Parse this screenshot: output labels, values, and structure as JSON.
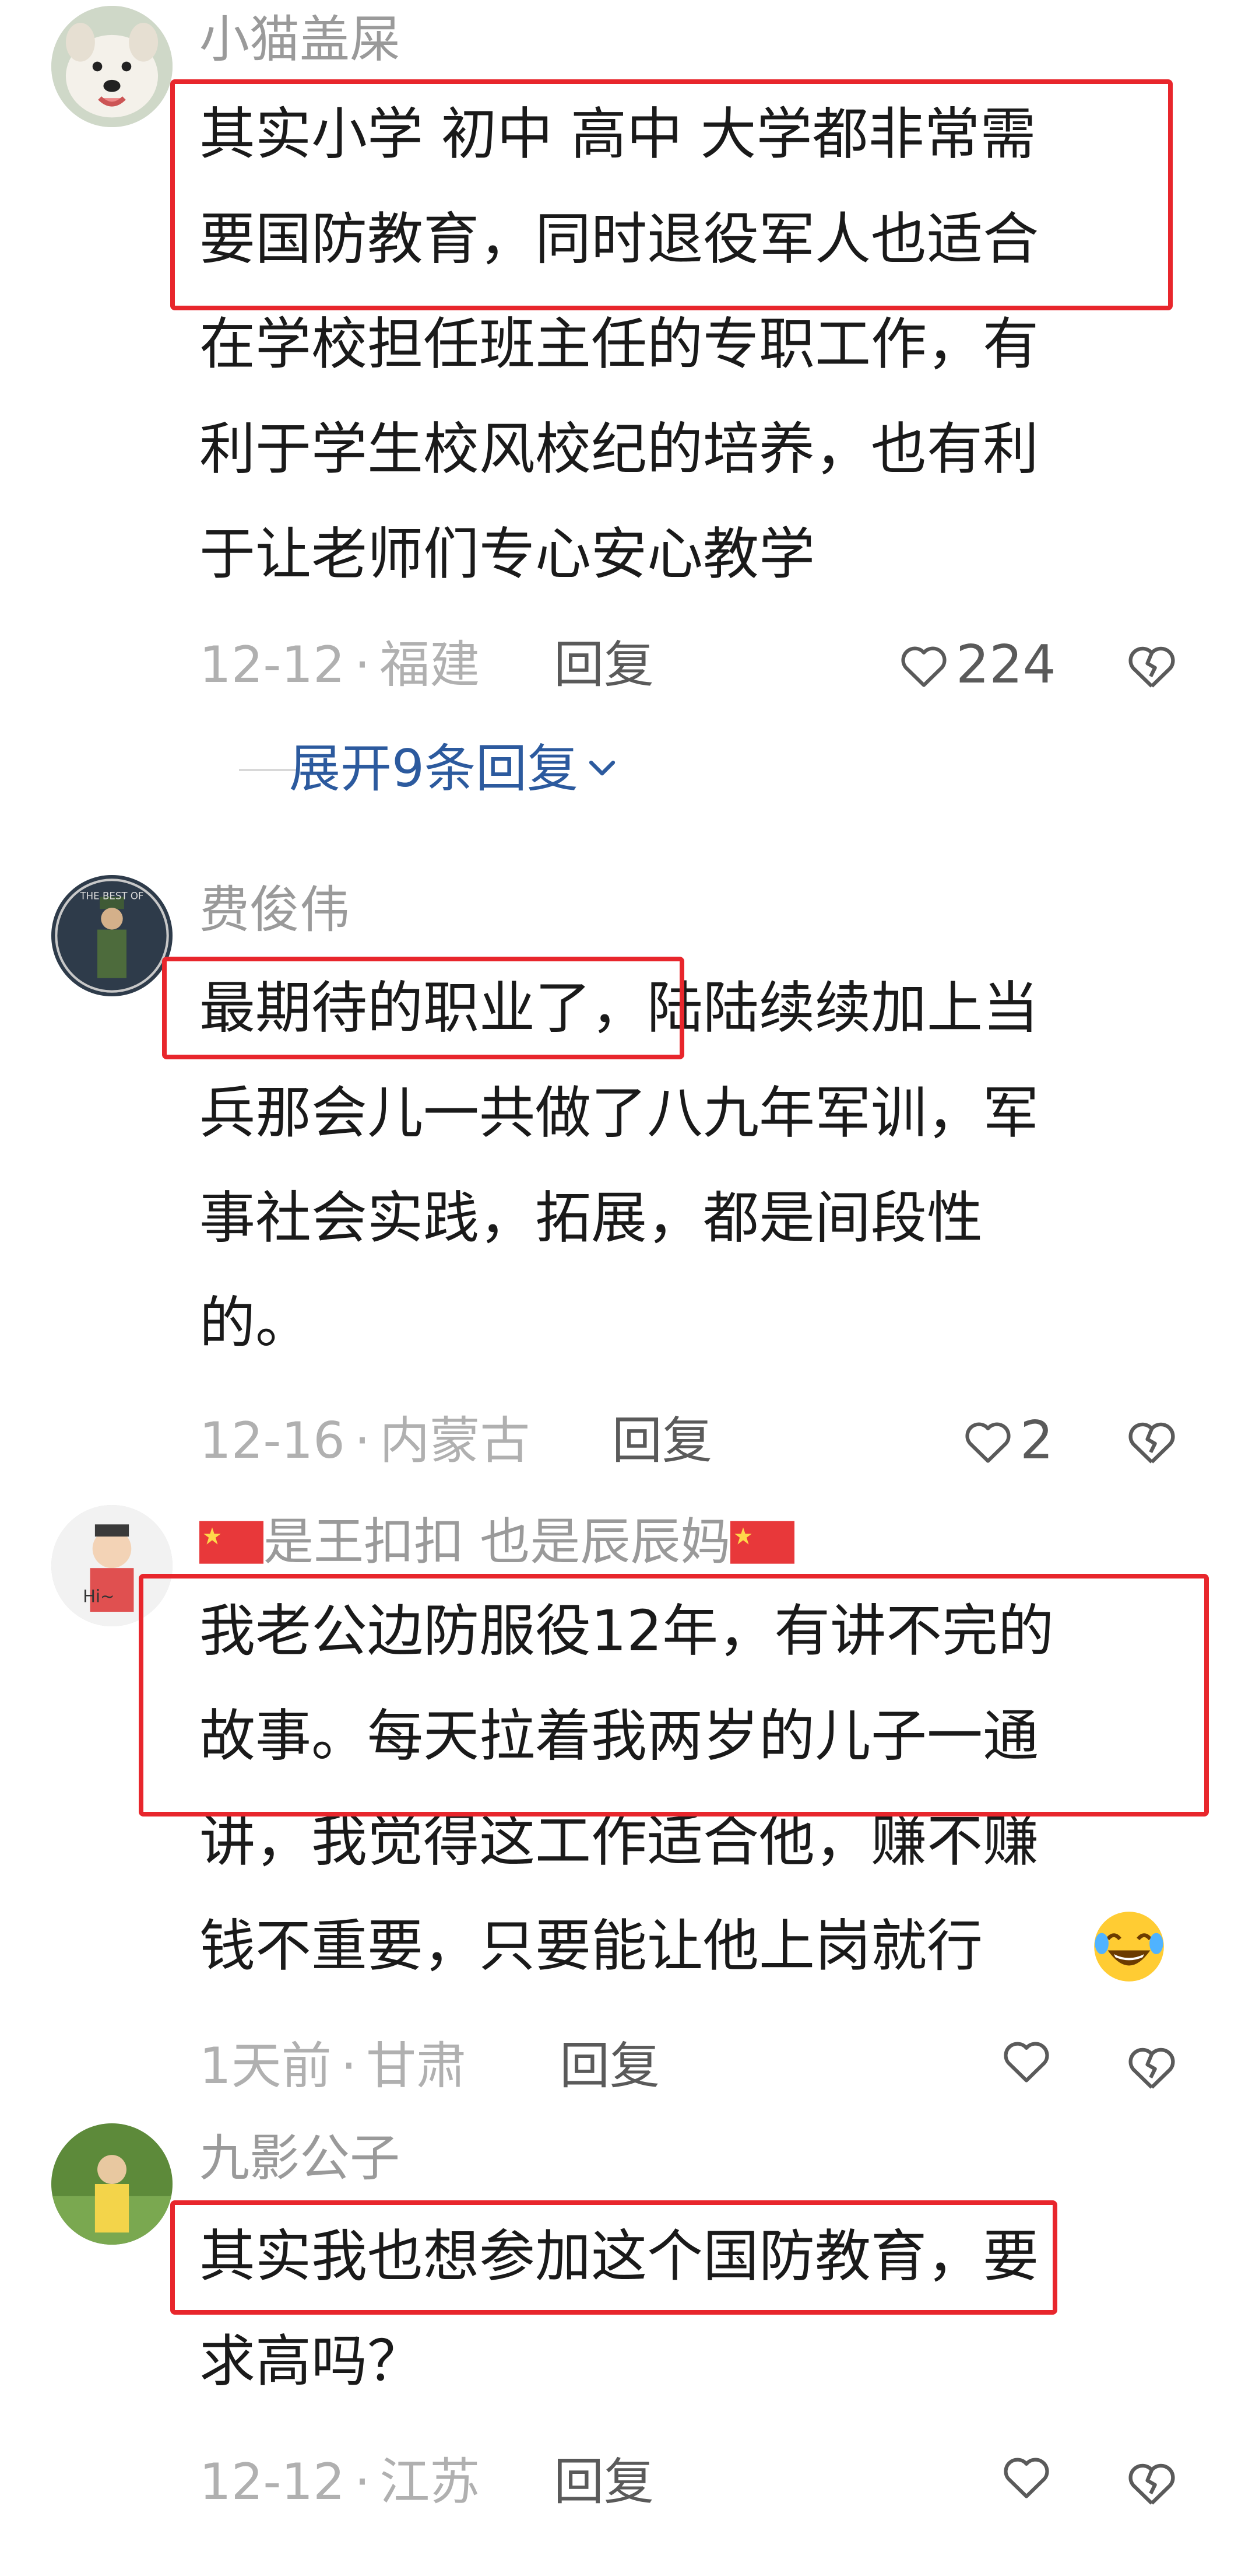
{
  "comments": [
    {
      "username": "小猫盖屎",
      "lines": [
        "其实小学 初中 高中 大学都非常需",
        "要国防教育，同时退役军人也适合",
        "在学校担任班主任的专职工作，有",
        "利于学生校风校纪的培养，也有利",
        "于让老师们专心安心教学"
      ],
      "date": "12-12",
      "location": "福建",
      "reply_label": "回复",
      "likes": "224",
      "expand_label": "展开9条回复"
    },
    {
      "username": "费俊伟",
      "lines": [
        "最期待的职业了，陆陆续续加上当",
        "兵那会儿一共做了八九年军训，军",
        "事社会实践，拓展，都是间段性",
        "的。"
      ],
      "date": "12-16",
      "location": "内蒙古",
      "reply_label": "回复",
      "likes": "2"
    },
    {
      "username": "是王扣扣  也是辰辰妈",
      "lines": [
        "我老公边防服役12年，有讲不完的",
        "故事。每天拉着我两岁的儿子一通",
        "讲，我觉得这工作适合他，赚不赚",
        "钱不重要，只要能让他上岗就行"
      ],
      "date": "1天前",
      "location": "甘肃",
      "reply_label": "回复",
      "likes": ""
    },
    {
      "username": "九影公子",
      "lines": [
        "其实我也想参加这个国防教育，要",
        "求高吗？"
      ],
      "date": "12-12",
      "location": "江苏",
      "reply_label": "回复",
      "likes": ""
    }
  ],
  "meta_separator": "·",
  "icons": {
    "like": "heart-outline-icon",
    "dislike": "broken-heart-icon",
    "expand": "chevron-down-icon",
    "flag": "china-flag-icon",
    "emoji": "laughing-crying-emoji-icon"
  },
  "colors": {
    "highlight_box": "#e8262c",
    "link": "#2c5a9e",
    "muted": "#9a9a9a"
  }
}
